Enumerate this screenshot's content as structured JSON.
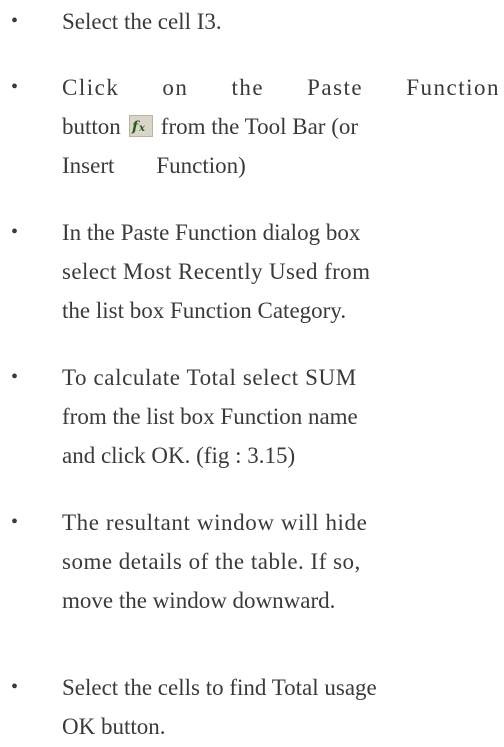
{
  "bullets": [
    {
      "lines": [
        "Select the cell I3."
      ]
    },
    {
      "line1_words": [
        "Click",
        "on",
        "the",
        "Paste",
        "Function"
      ],
      "line2_before": "button",
      "line2_icon": "paste-function-fx-icon",
      "line2_after": "from the Tool Bar (or",
      "line3_a": "Insert",
      "line3_b": "Function)"
    },
    {
      "lines": [
        "In the Paste Function dialog box",
        "select Most Recently Used from",
        "the list box Function Category."
      ]
    },
    {
      "lines": [
        "To calculate Total select SUM",
        "from the list box Function name",
        "and click OK. (fig : 3.15)"
      ]
    },
    {
      "lines": [
        "The resultant window will hide",
        "some details of the table. If so,",
        "move the window downward."
      ]
    },
    {
      "lines": [
        "Select the cells to find Total usage",
        "OK button."
      ]
    }
  ],
  "bullet_symbol": "•",
  "colors": {
    "text": "#3a3a3a",
    "icon_bg": "#d9d5c8",
    "icon_glyph": "#2a5a1a"
  }
}
